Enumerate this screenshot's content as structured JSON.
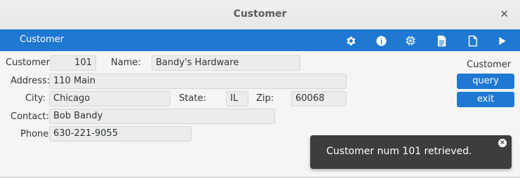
{
  "window": {
    "title": "Customer"
  },
  "toolbar": {
    "title": "Customer",
    "icons": [
      "gear-icon",
      "info-icon",
      "chip-icon",
      "document-icon",
      "blank-page-icon",
      "play-icon"
    ]
  },
  "form": {
    "customer_label": "Customer:",
    "customer_value": "101",
    "name_label": "Name:",
    "name_value": "Bandy's Hardware",
    "address_label": "Address:",
    "address_value": "110 Main",
    "city_label": "City:",
    "city_value": "Chicago",
    "state_label": "State:",
    "state_value": "IL",
    "zip_label": "Zip:",
    "zip_value": "60068",
    "contact_label": "Contact:",
    "contact_value": "Bob Bandy",
    "phone_label": "Phone:",
    "phone_value": "630-221-9055"
  },
  "side_panel": {
    "title": "Customer",
    "query_label": "query",
    "exit_label": "exit"
  },
  "toast": {
    "message": "Customer num 101 retrieved.",
    "close_glyph": "×"
  },
  "colors": {
    "accent": "#1f78d1",
    "toast_bg": "#3d3d3d"
  }
}
